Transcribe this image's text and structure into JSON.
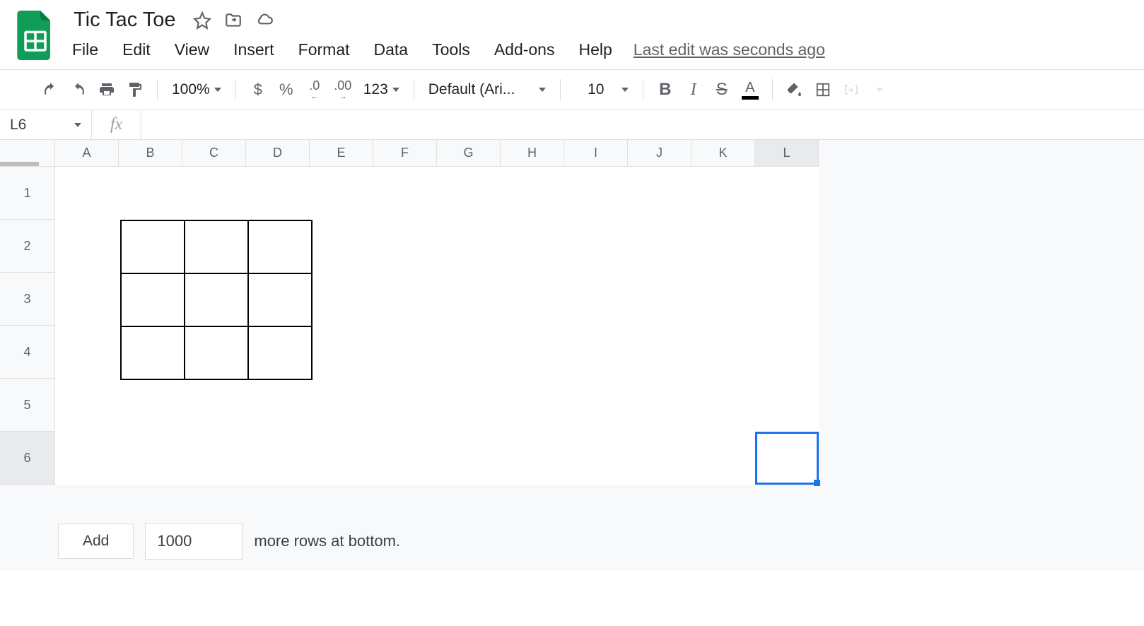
{
  "doc_title": "Tic Tac Toe",
  "menu": [
    "File",
    "Edit",
    "View",
    "Insert",
    "Format",
    "Data",
    "Tools",
    "Add-ons",
    "Help"
  ],
  "last_edit": "Last edit was seconds ago",
  "toolbar": {
    "zoom": "100%",
    "font": "Default (Ari...",
    "font_size": "10",
    "more_formats": "123"
  },
  "name_box": "L6",
  "columns": [
    "A",
    "B",
    "C",
    "D",
    "E",
    "F",
    "G",
    "H",
    "I",
    "J",
    "K",
    "L"
  ],
  "rows": [
    "1",
    "2",
    "3",
    "4",
    "5",
    "6"
  ],
  "selected_col": "L",
  "selected_row": "6",
  "ttt": {
    "range": "B2:D4",
    "cells": [
      [
        "",
        "",
        ""
      ],
      [
        "",
        "",
        ""
      ],
      [
        "",
        "",
        ""
      ]
    ]
  },
  "footer": {
    "add_label": "Add",
    "rows_value": "1000",
    "suffix": "more rows at bottom."
  }
}
